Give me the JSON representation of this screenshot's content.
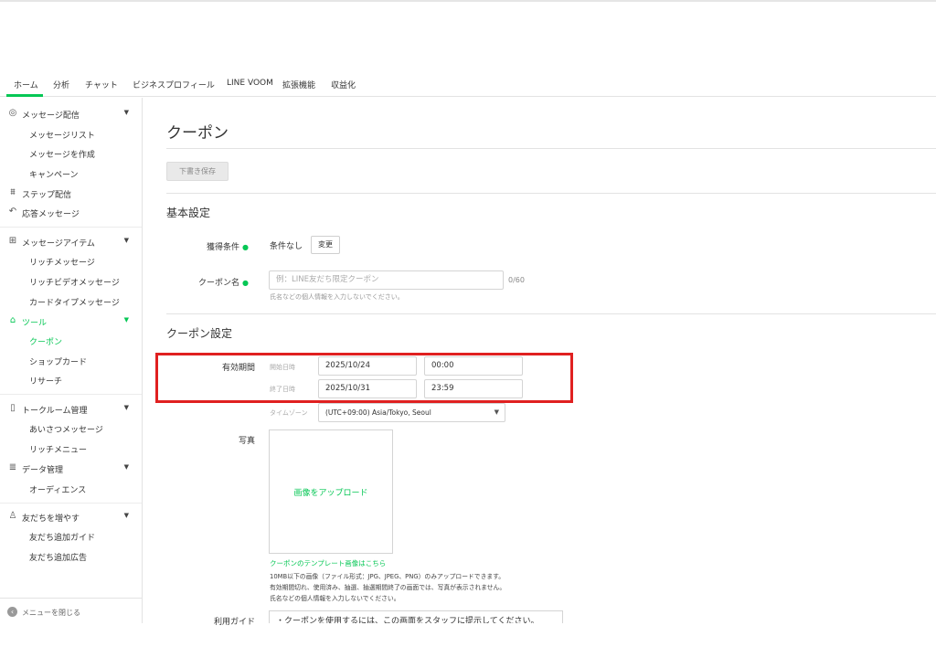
{
  "nav": {
    "tabs": [
      "ホーム",
      "分析",
      "チャット",
      "ビジネスプロフィール",
      "LINE VOOM",
      "拡張機能",
      "収益化"
    ]
  },
  "sidebar": {
    "message_delivery": "メッセージ配信",
    "message_list": "メッセージリスト",
    "create_message": "メッセージを作成",
    "campaign": "キャンペーン",
    "step_delivery": "ステップ配信",
    "response_message": "応答メッセージ",
    "message_items": "メッセージアイテム",
    "rich_message": "リッチメッセージ",
    "rich_video_message": "リッチビデオメッセージ",
    "card_type_message": "カードタイプメッセージ",
    "tools": "ツール",
    "coupon": "クーポン",
    "shop_card": "ショップカード",
    "research": "リサーチ",
    "talk_room": "トークルーム管理",
    "greeting_message": "あいさつメッセージ",
    "rich_menu": "リッチメニュー",
    "data_management": "データ管理",
    "audience": "オーディエンス",
    "increase_friends": "友だちを増やす",
    "friend_add_guide": "友だち追加ガイド",
    "friend_add_ads": "友だち追加広告",
    "close_menu": "メニューを閉じる"
  },
  "main": {
    "title": "クーポン",
    "draft_save": "下書き保存",
    "basic_settings": "基本設定",
    "acquisition_label": "獲得条件",
    "acquisition_value": "条件なし",
    "change_button": "変更",
    "coupon_name_label": "クーポン名",
    "coupon_name_placeholder": "例：LINE友だち限定クーポン",
    "coupon_name_counter": "0/60",
    "coupon_name_hint": "氏名などの個人情報を入力しないでください。",
    "coupon_settings": "クーポン設定",
    "validity_label": "有効期間",
    "start_label": "開始日時",
    "start_date": "2025/10/24",
    "start_time": "00:00",
    "end_label": "終了日時",
    "end_date": "2025/10/31",
    "end_time": "23:59",
    "timezone_label": "タイムゾーン",
    "timezone_value": "(UTC+09:00) Asia/Tokyo, Seoul",
    "photo_label": "写真",
    "upload_label": "画像をアップロード",
    "template_link": "クーポンのテンプレート画像はこちら",
    "note1": "10MB以下の画像（ファイル形式：JPG、JPEG、PNG）のみアップロードできます。",
    "note2": "有効期間切れ、使用済み、抽選、抽選期間終了の画面では、写真が表示されません。",
    "note3": "氏名などの個人情報を入力しないでください。",
    "usage_guide_label": "利用ガイド",
    "usage_guide_value": "・クーポンを使用するには、この画面をスタッフに提示してください。"
  },
  "colors": {
    "accent": "#06c755",
    "highlight": "#e02020"
  }
}
